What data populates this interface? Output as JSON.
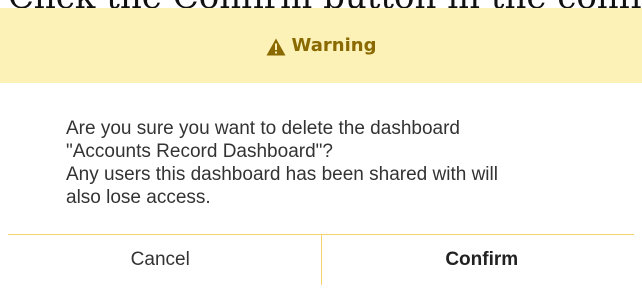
{
  "instruction": "Click the Confirm button in the confirm",
  "dialog": {
    "header_title": "Warning",
    "header_icon": "warning-triangle-icon",
    "accent_color": "#fcf2b8",
    "message_line1": "Are you sure you want to delete the dashboard",
    "message_line2": "\"Accounts Record Dashboard\"?",
    "message_line3": "Any users this dashboard has been shared with will",
    "message_line4": "also lose access.",
    "cancel_label": "Cancel",
    "confirm_label": "Confirm"
  }
}
